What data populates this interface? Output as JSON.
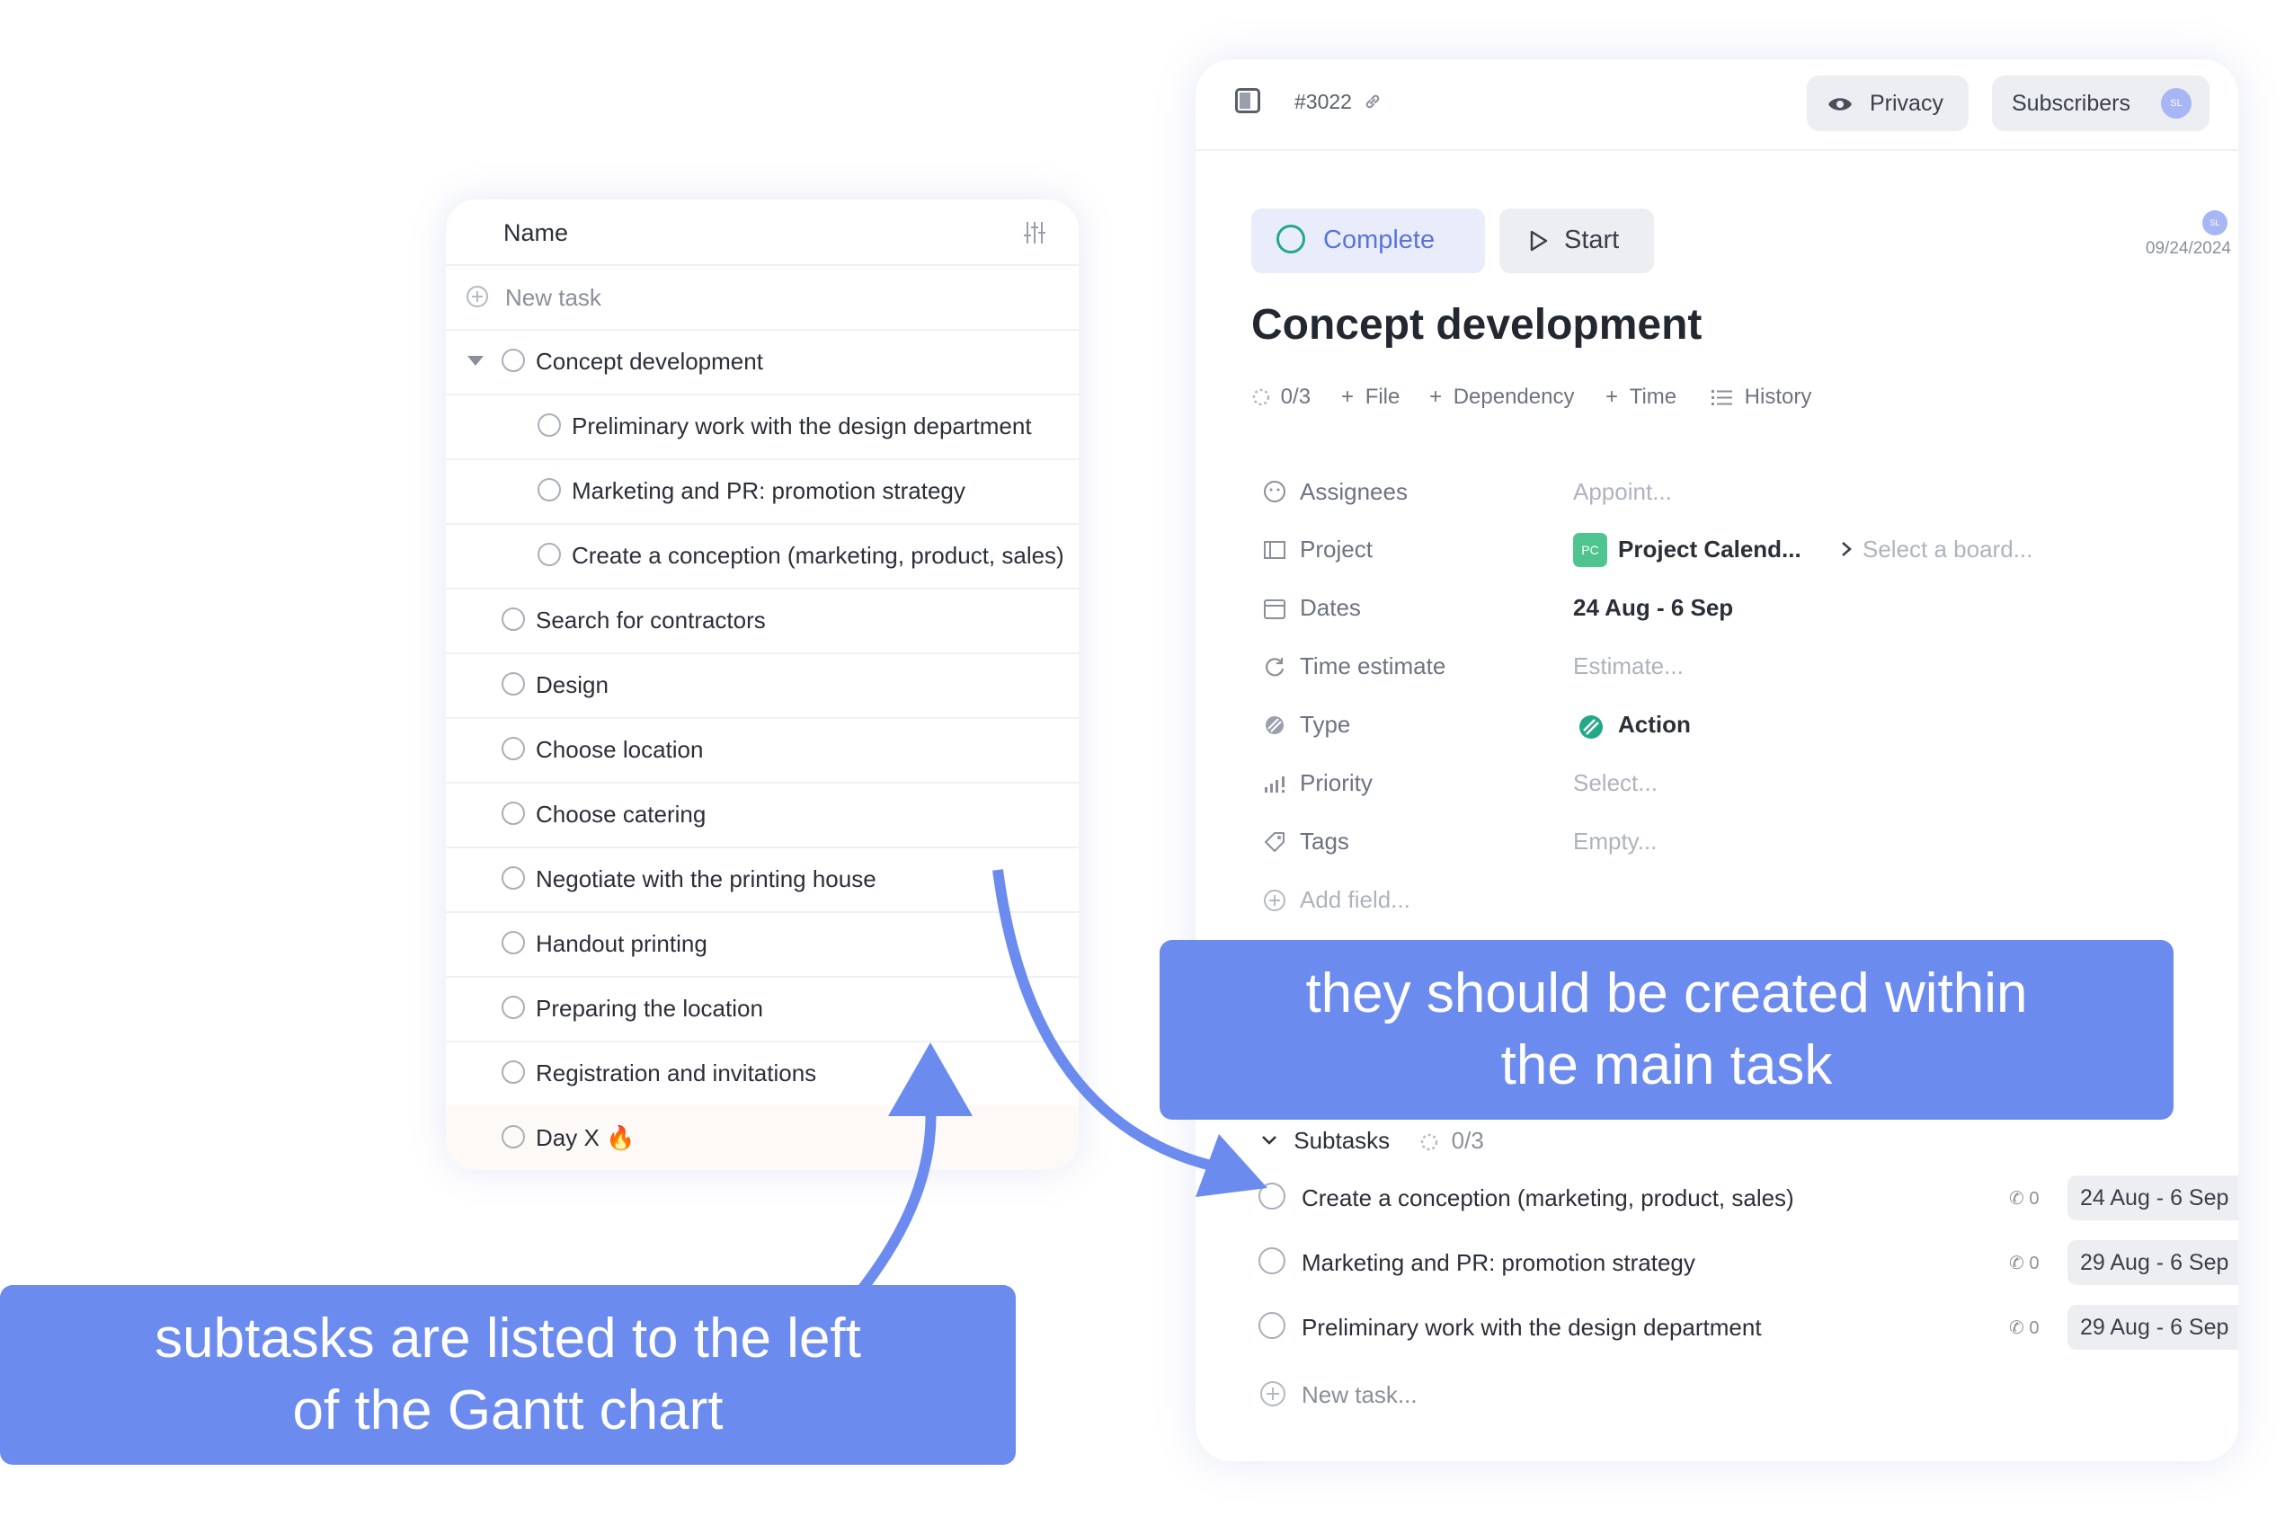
{
  "left_list": {
    "header": "Name",
    "new_task": "New task",
    "parent": "Concept development",
    "children": [
      "Preliminary work with the design department",
      "Marketing and PR: promotion strategy",
      "Create a conception (marketing, product, sales)"
    ],
    "tasks": [
      "Search for contractors",
      "Design",
      "Choose location",
      "Choose catering",
      "Negotiate with the printing house",
      "Handout printing",
      "Preparing the location",
      "Registration and invitations",
      "Day X 🔥"
    ]
  },
  "detail": {
    "task_id": "#3022",
    "privacy": "Privacy",
    "subscribers": "Subscribers",
    "avatar_initials": "SL",
    "complete": "Complete",
    "start": "Start",
    "date": "09/24/2024",
    "title": "Concept development",
    "actions": {
      "progress": "0/3",
      "file": "File",
      "dependency": "Dependency",
      "time": "Time",
      "history": "History"
    },
    "fields": {
      "assignees": {
        "label": "Assignees",
        "value": "Appoint..."
      },
      "project": {
        "label": "Project",
        "badge": "PC",
        "value": "Project Calend...",
        "board": "Select a board..."
      },
      "dates": {
        "label": "Dates",
        "value": "24 Aug - 6 Sep"
      },
      "time_estimate": {
        "label": "Time estimate",
        "value": "Estimate..."
      },
      "type": {
        "label": "Type",
        "value": "Action"
      },
      "priority": {
        "label": "Priority",
        "value": "Select..."
      },
      "tags": {
        "label": "Tags",
        "value": "Empty..."
      },
      "add_field": "Add field..."
    },
    "subtasks": {
      "label": "Subtasks",
      "progress": "0/3",
      "items": [
        {
          "name": "Create a conception (marketing, product, sales)",
          "count": "0",
          "dates": "24 Aug - 6 Sep"
        },
        {
          "name": "Marketing and PR: promotion strategy",
          "count": "0",
          "dates": "29 Aug - 6 Sep"
        },
        {
          "name": "Preliminary work with the design department",
          "count": "0",
          "dates": "29 Aug - 6 Sep"
        }
      ],
      "new_task": "New task..."
    }
  },
  "callouts": {
    "right": [
      "they should be created within",
      "the main task"
    ],
    "left": [
      "subtasks are listed to the left",
      "of the Gantt chart"
    ]
  },
  "colors": {
    "accent": "#6c8bef",
    "complete_ring": "#24a889",
    "project_badge": "#4fc48f"
  }
}
